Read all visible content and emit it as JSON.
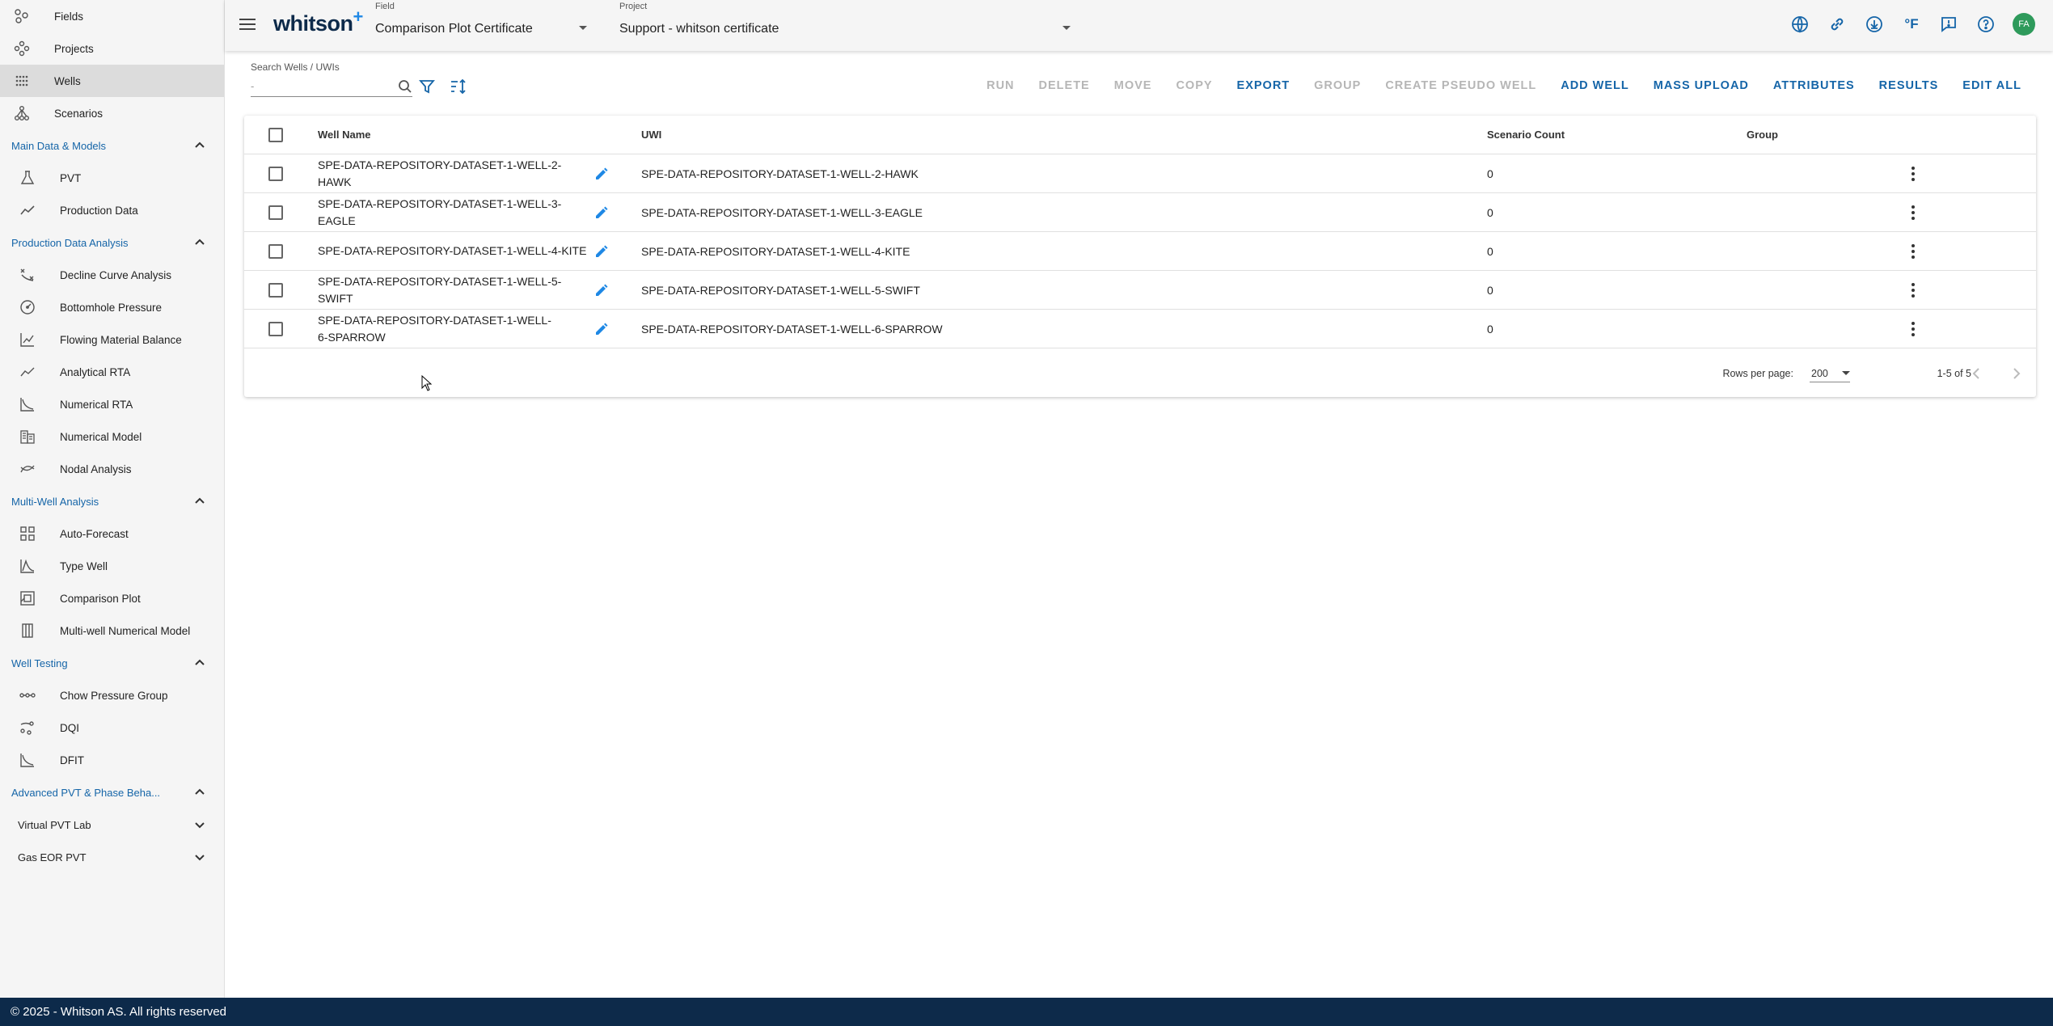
{
  "sidebar": {
    "top_items": [
      {
        "label": "Fields",
        "icon": "fields-icon"
      },
      {
        "label": "Projects",
        "icon": "projects-icon"
      },
      {
        "label": "Wells",
        "icon": "wells-icon",
        "active": true
      },
      {
        "label": "Scenarios",
        "icon": "scenarios-icon"
      }
    ],
    "sections": [
      {
        "title": "Main Data & Models",
        "items": [
          {
            "label": "PVT",
            "icon": "flask-icon"
          },
          {
            "label": "Production Data",
            "icon": "trend-icon"
          }
        ]
      },
      {
        "title": "Production Data Analysis",
        "items": [
          {
            "label": "Decline Curve Analysis",
            "icon": "decline-icon"
          },
          {
            "label": "Bottomhole Pressure",
            "icon": "gauge-icon"
          },
          {
            "label": "Flowing Material Balance",
            "icon": "chart-icon"
          },
          {
            "label": "Analytical RTA",
            "icon": "trend-icon"
          },
          {
            "label": "Numerical RTA",
            "icon": "curve-icon"
          },
          {
            "label": "Numerical Model",
            "icon": "grid-building-icon"
          },
          {
            "label": "Nodal Analysis",
            "icon": "nodal-icon"
          }
        ]
      },
      {
        "title": "Multi-Well Analysis",
        "items": [
          {
            "label": "Auto-Forecast",
            "icon": "grid-icon"
          },
          {
            "label": "Type Well",
            "icon": "typewell-icon"
          },
          {
            "label": "Comparison Plot",
            "icon": "comparison-icon"
          },
          {
            "label": "Multi-well Numerical Model",
            "icon": "columns-icon"
          }
        ]
      },
      {
        "title": "Well Testing",
        "items": [
          {
            "label": "Chow Pressure Group",
            "icon": "chow-icon"
          },
          {
            "label": "DQI",
            "icon": "dqi-icon"
          },
          {
            "label": "DFIT",
            "icon": "dfit-icon"
          }
        ]
      },
      {
        "title": "Advanced PVT & Phase Beha...",
        "items": []
      }
    ],
    "collapsed": [
      {
        "label": "Virtual PVT Lab"
      },
      {
        "label": "Gas EOR PVT"
      }
    ]
  },
  "topbar": {
    "logo": "whitson",
    "logo_plus": "+",
    "field_label": "Field",
    "field_value": "Comparison Plot Certificate",
    "project_label": "Project",
    "project_value": "Support - whitson certificate",
    "temp_unit": "°F",
    "avatar_initials": "FA"
  },
  "search": {
    "label": "Search Wells / UWIs",
    "value": "-"
  },
  "actions": [
    {
      "label": "RUN",
      "enabled": false
    },
    {
      "label": "DELETE",
      "enabled": false
    },
    {
      "label": "MOVE",
      "enabled": false
    },
    {
      "label": "COPY",
      "enabled": false
    },
    {
      "label": "EXPORT",
      "enabled": true
    },
    {
      "label": "GROUP",
      "enabled": false
    },
    {
      "label": "CREATE PSEUDO WELL",
      "enabled": false
    },
    {
      "label": "ADD WELL",
      "enabled": true
    },
    {
      "label": "MASS UPLOAD",
      "enabled": true
    },
    {
      "label": "ATTRIBUTES",
      "enabled": true
    },
    {
      "label": "RESULTS",
      "enabled": true
    },
    {
      "label": "EDIT ALL",
      "enabled": true
    }
  ],
  "table": {
    "columns": [
      "Well Name",
      "UWI",
      "Scenario Count",
      "Group"
    ],
    "rows": [
      {
        "name": "SPE-DATA-REPOSITORY-DATASET-1-WELL-2-HAWK",
        "uwi": "SPE-DATA-REPOSITORY-DATASET-1-WELL-2-HAWK",
        "scenarios": "0",
        "group": ""
      },
      {
        "name": "SPE-DATA-REPOSITORY-DATASET-1-WELL-3-EAGLE",
        "uwi": "SPE-DATA-REPOSITORY-DATASET-1-WELL-3-EAGLE",
        "scenarios": "0",
        "group": ""
      },
      {
        "name": "SPE-DATA-REPOSITORY-DATASET-1-WELL-4-KITE",
        "uwi": "SPE-DATA-REPOSITORY-DATASET-1-WELL-4-KITE",
        "scenarios": "0",
        "group": ""
      },
      {
        "name": "SPE-DATA-REPOSITORY-DATASET-1-WELL-5-SWIFT",
        "uwi": "SPE-DATA-REPOSITORY-DATASET-1-WELL-5-SWIFT",
        "scenarios": "0",
        "group": ""
      },
      {
        "name": "SPE-DATA-REPOSITORY-DATASET-1-WELL-6-SPARROW",
        "uwi": "SPE-DATA-REPOSITORY-DATASET-1-WELL-6-SPARROW",
        "scenarios": "0",
        "group": ""
      }
    ],
    "rows_per_page_label": "Rows per page:",
    "rows_per_page": "200",
    "range": "1-5 of 5"
  },
  "footer": {
    "copyright": "© 2025 - Whitson AS. All rights reserved"
  },
  "colors": {
    "accent": "#1565a8",
    "footer_bg": "#0d2a4a",
    "avatar_bg": "#2e9a5b",
    "disabled": "#b6b6b6"
  }
}
